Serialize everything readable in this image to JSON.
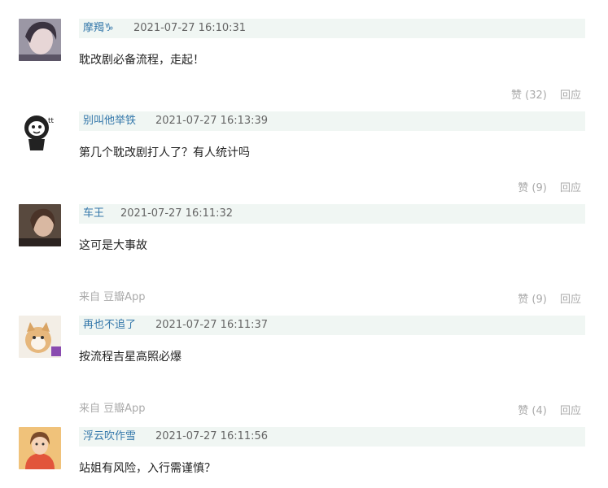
{
  "comments": [
    {
      "user": "摩羯♑",
      "time": "2021-07-27 16:10:31",
      "text": "耽改剧必备流程，走起！",
      "source": "",
      "vote": "赞 (32)",
      "reply": "回应"
    },
    {
      "user": "别叫他举铁",
      "time": "2021-07-27 16:13:39",
      "text": "第几个耽改剧打人了？有人统计吗",
      "source": "",
      "vote": "赞 (9)",
      "reply": "回应"
    },
    {
      "user": "车王",
      "time": "2021-07-27 16:11:32",
      "text": "这可是大事故",
      "source": "来自 豆瓣App",
      "vote": "赞 (9)",
      "reply": "回应"
    },
    {
      "user": "再也不追了",
      "time": "2021-07-27 16:11:37",
      "text": "按流程吉星高照必爆",
      "source": "来自 豆瓣App",
      "vote": "赞 (4)",
      "reply": "回应"
    },
    {
      "user": "浮云吹作雪",
      "time": "2021-07-27 16:11:56",
      "text": "站姐有风险，入行需谨慎？",
      "source": "",
      "vote": "",
      "reply": ""
    }
  ],
  "colors": {
    "username": "#3377aa",
    "meta_bg": "#f0f6f3",
    "muted": "#aaaaaa",
    "body_text": "#222222"
  }
}
